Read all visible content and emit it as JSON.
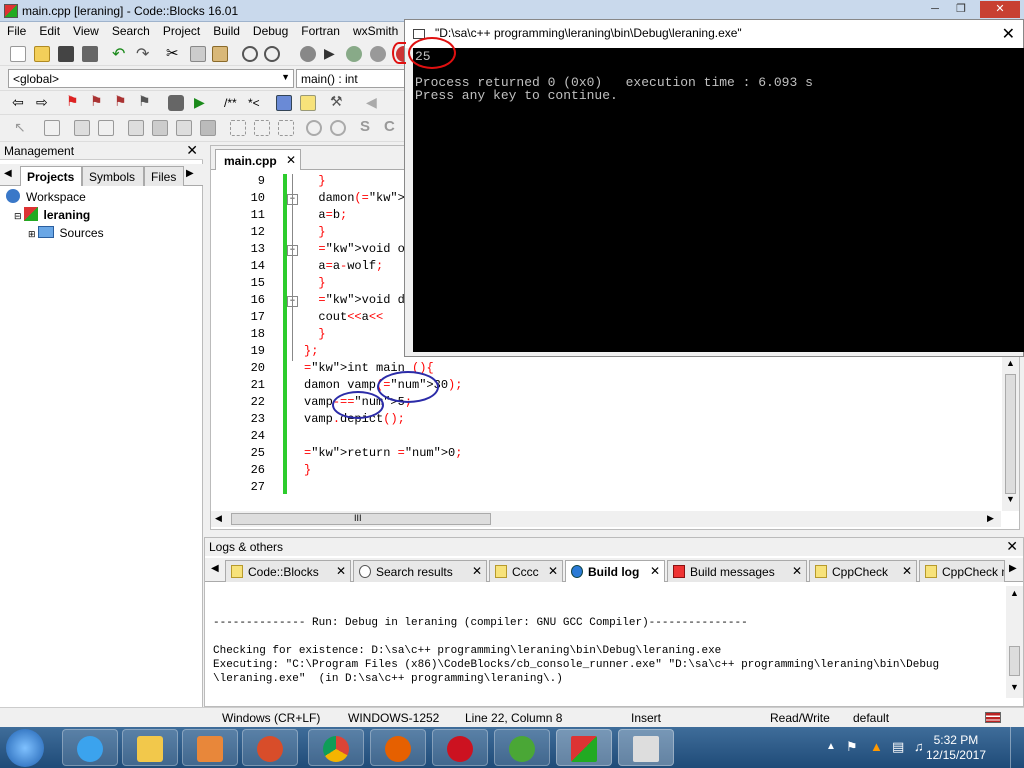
{
  "window": {
    "title": "main.cpp [leraning] - Code::Blocks 16.01"
  },
  "menu": [
    "File",
    "Edit",
    "View",
    "Search",
    "Project",
    "Build",
    "Debug",
    "Fortran",
    "wxSmith"
  ],
  "combos": {
    "scope": "<global>",
    "func": "main() : int"
  },
  "toolbar_text": {
    "comment": "/**",
    "tag": "*<"
  },
  "management": {
    "title": "Management",
    "tabs": [
      "Projects",
      "Symbols",
      "Files"
    ],
    "tree": {
      "workspace": "Workspace",
      "project": "leraning",
      "sources": "Sources"
    }
  },
  "editor": {
    "tab": "main.cpp",
    "lines": [
      {
        "n": "9",
        "code": "  }"
      },
      {
        "n": "10",
        "code": "  damon(int"
      },
      {
        "n": "11",
        "code": "  a=b;"
      },
      {
        "n": "12",
        "code": "  }"
      },
      {
        "n": "13",
        "code": "  void oper"
      },
      {
        "n": "14",
        "code": "  a=a-wolf;"
      },
      {
        "n": "15",
        "code": "  }"
      },
      {
        "n": "16",
        "code": "  void depi"
      },
      {
        "n": "17",
        "code": "  cout<<a<<"
      },
      {
        "n": "18",
        "code": "  }"
      },
      {
        "n": "19",
        "code": "};"
      },
      {
        "n": "20",
        "code": "int main (){"
      },
      {
        "n": "21",
        "code": "damon vamp(30);"
      },
      {
        "n": "22",
        "code": "vamp-=5;"
      },
      {
        "n": "23",
        "code": "vamp.depict();"
      },
      {
        "n": "24",
        "code": ""
      },
      {
        "n": "25",
        "code": "return 0;"
      },
      {
        "n": "26",
        "code": "}"
      },
      {
        "n": "27",
        "code": ""
      }
    ],
    "scroll_mark": "III"
  },
  "console": {
    "title": "\"D:\\sa\\c++ programming\\leraning\\bin\\Debug\\leraning.exe\"",
    "output": "25\n\nProcess returned 0 (0x0)   execution time : 6.093 s\nPress any key to continue."
  },
  "logs": {
    "title": "Logs & others",
    "tabs": [
      "Code::Blocks",
      "Search results",
      "Cccc",
      "Build log",
      "Build messages",
      "CppCheck",
      "CppCheck me"
    ],
    "active_tab": "Build log",
    "text": "-------------- Run: Debug in leraning (compiler: GNU GCC Compiler)---------------\n\nChecking for existence: D:\\sa\\c++ programming\\leraning\\bin\\Debug\\leraning.exe\nExecuting: \"C:\\Program Files (x86)\\CodeBlocks/cb_console_runner.exe\" \"D:\\sa\\c++ programming\\leraning\\bin\\Debug\n\\leraning.exe\"  (in D:\\sa\\c++ programming\\leraning\\.)"
  },
  "status": {
    "eol": "Windows (CR+LF)",
    "encoding": "WINDOWS-1252",
    "position": "Line 22, Column 8",
    "mode": "Insert",
    "access": "Read/Write",
    "profile": "default"
  },
  "clock": {
    "time": "5:32 PM",
    "date": "12/15/2017"
  },
  "colors": {
    "accent_green": "#2dcc2d",
    "annotation_red": "#e01010",
    "annotation_blue": "#2b2ba8"
  }
}
